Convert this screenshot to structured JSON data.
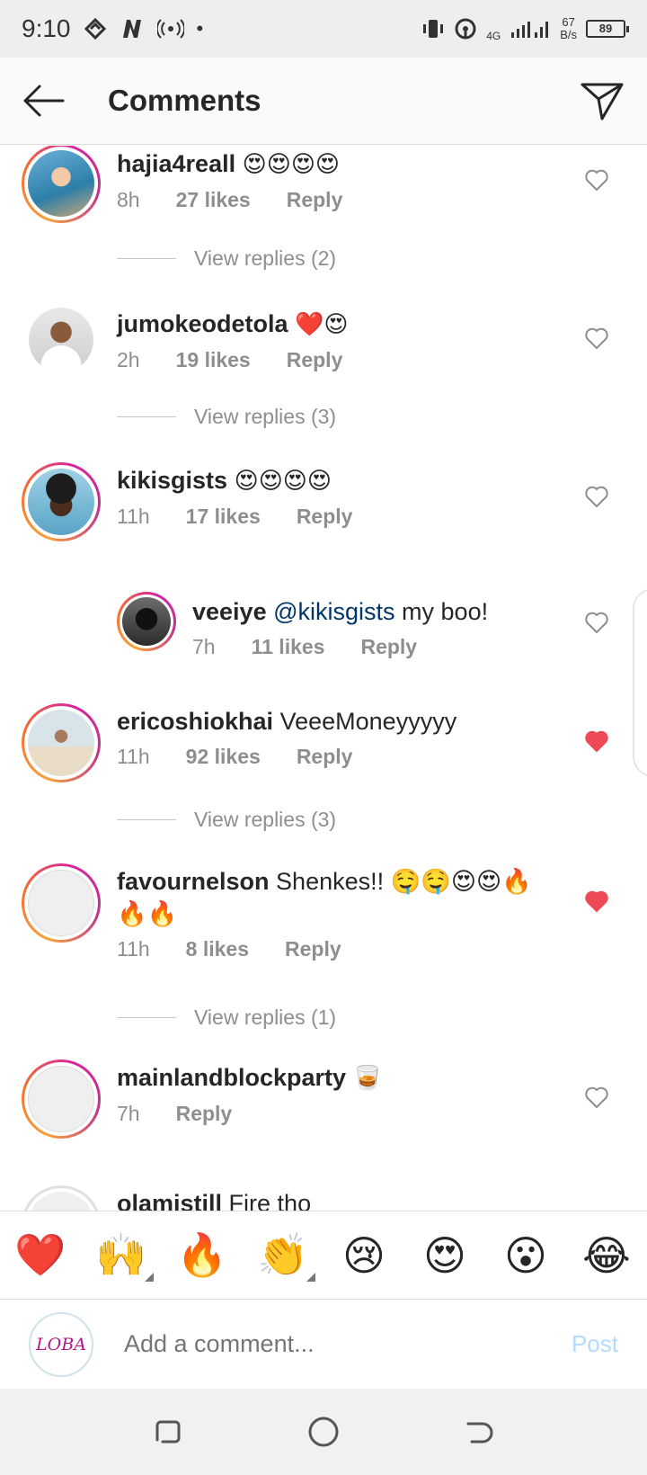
{
  "status_bar": {
    "time": "9:10",
    "network_type": "4G",
    "speed_value": "67",
    "speed_unit": "B/s",
    "battery": "89"
  },
  "header": {
    "title": "Comments"
  },
  "comments": [
    {
      "username": "hajia4reall",
      "text": "😍😍😍😍",
      "time": "8h",
      "likes": "27 likes",
      "reply": "Reply",
      "liked": false,
      "view_replies": "View replies (2)"
    },
    {
      "username": "jumokeodetola",
      "text": "❤️😍",
      "time": "2h",
      "likes": "19 likes",
      "reply": "Reply",
      "liked": false,
      "view_replies": "View replies (3)"
    },
    {
      "username": "kikisgists",
      "text": "😍😍😍😍",
      "time": "11h",
      "likes": "17 likes",
      "reply": "Reply",
      "liked": false,
      "reply_item": {
        "username": "veeiye",
        "mention": "@kikisgists",
        "text": "my boo!",
        "time": "7h",
        "likes": "11 likes",
        "reply": "Reply",
        "liked": false
      }
    },
    {
      "username": "ericoshiokhai",
      "text": "VeeeMoneyyyyy",
      "time": "11h",
      "likes": "92 likes",
      "reply": "Reply",
      "liked": true,
      "view_replies": "View replies (3)"
    },
    {
      "username": "favournelson",
      "text": "Shenkes!! 🤤🤤😍😍🔥🔥🔥",
      "time": "11h",
      "likes": "8 likes",
      "reply": "Reply",
      "liked": true,
      "view_replies": "View replies (1)"
    },
    {
      "username": "mainlandblockparty",
      "text": "🥃",
      "time": "7h",
      "reply": "Reply",
      "liked": false
    },
    {
      "username": "olamistill",
      "text": "Fire tho"
    }
  ],
  "reactions": [
    "❤️",
    "🙌",
    "🔥",
    "👏",
    "😢",
    "😍",
    "😮",
    "😂"
  ],
  "input": {
    "avatar_text": "LOBA",
    "placeholder": "Add a comment...",
    "post_label": "Post"
  },
  "colors": {
    "accent_blue": "#b3dbff",
    "mention": "#003569",
    "like_red": "#ed4956",
    "muted": "#8e8e8e"
  }
}
